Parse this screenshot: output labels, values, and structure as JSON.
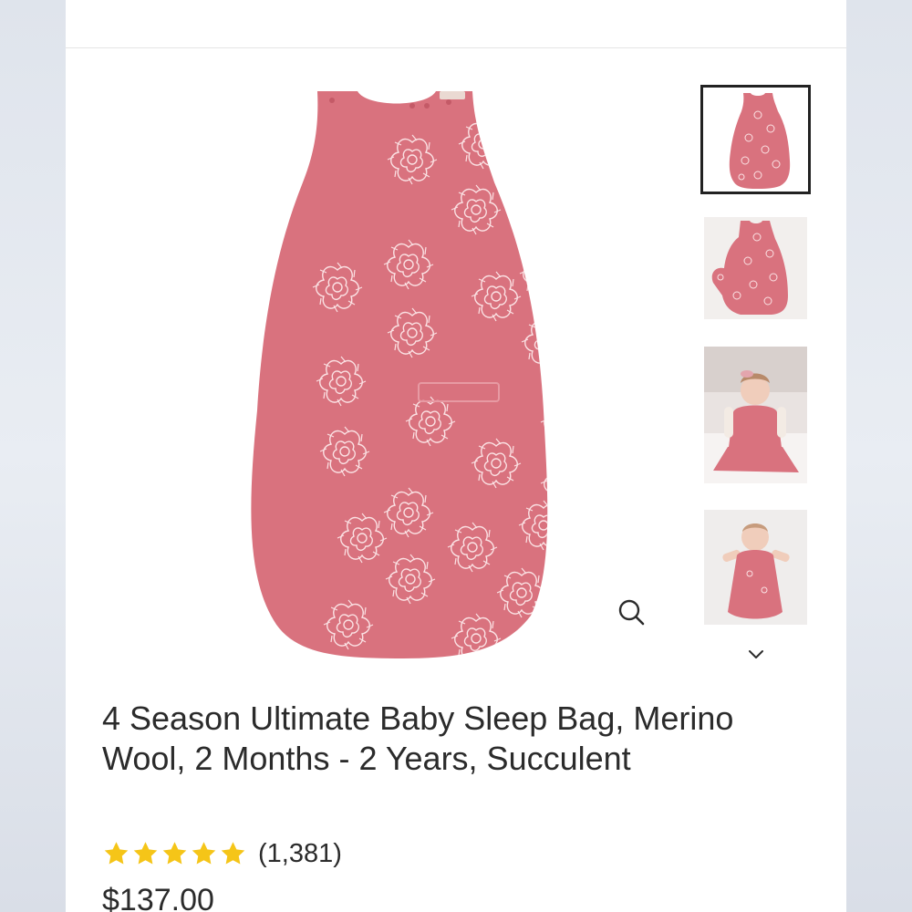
{
  "product": {
    "title": "4 Season Ultimate Baby Sleep Bag, Merino Wool, 2 Months - 2 Years, Succulent",
    "rating": 5,
    "rating_max": 5,
    "review_count": "(1,381)",
    "price": "$137.00"
  },
  "gallery": {
    "thumbnails": [
      {
        "name": "sleep-bag-front"
      },
      {
        "name": "sleep-bag-unzipped"
      },
      {
        "name": "baby-sitting-in-sleep-bag"
      },
      {
        "name": "baby-lying-in-sleep-bag"
      }
    ],
    "selected_index": 0
  },
  "icons": {
    "zoom": "magnifier-icon",
    "more_thumbnails": "chevron-down-icon",
    "star": "star-icon"
  },
  "colors": {
    "sleep_bag_pink": "#d9727e",
    "star_yellow": "#f5c518",
    "text": "#2b2b2b"
  }
}
